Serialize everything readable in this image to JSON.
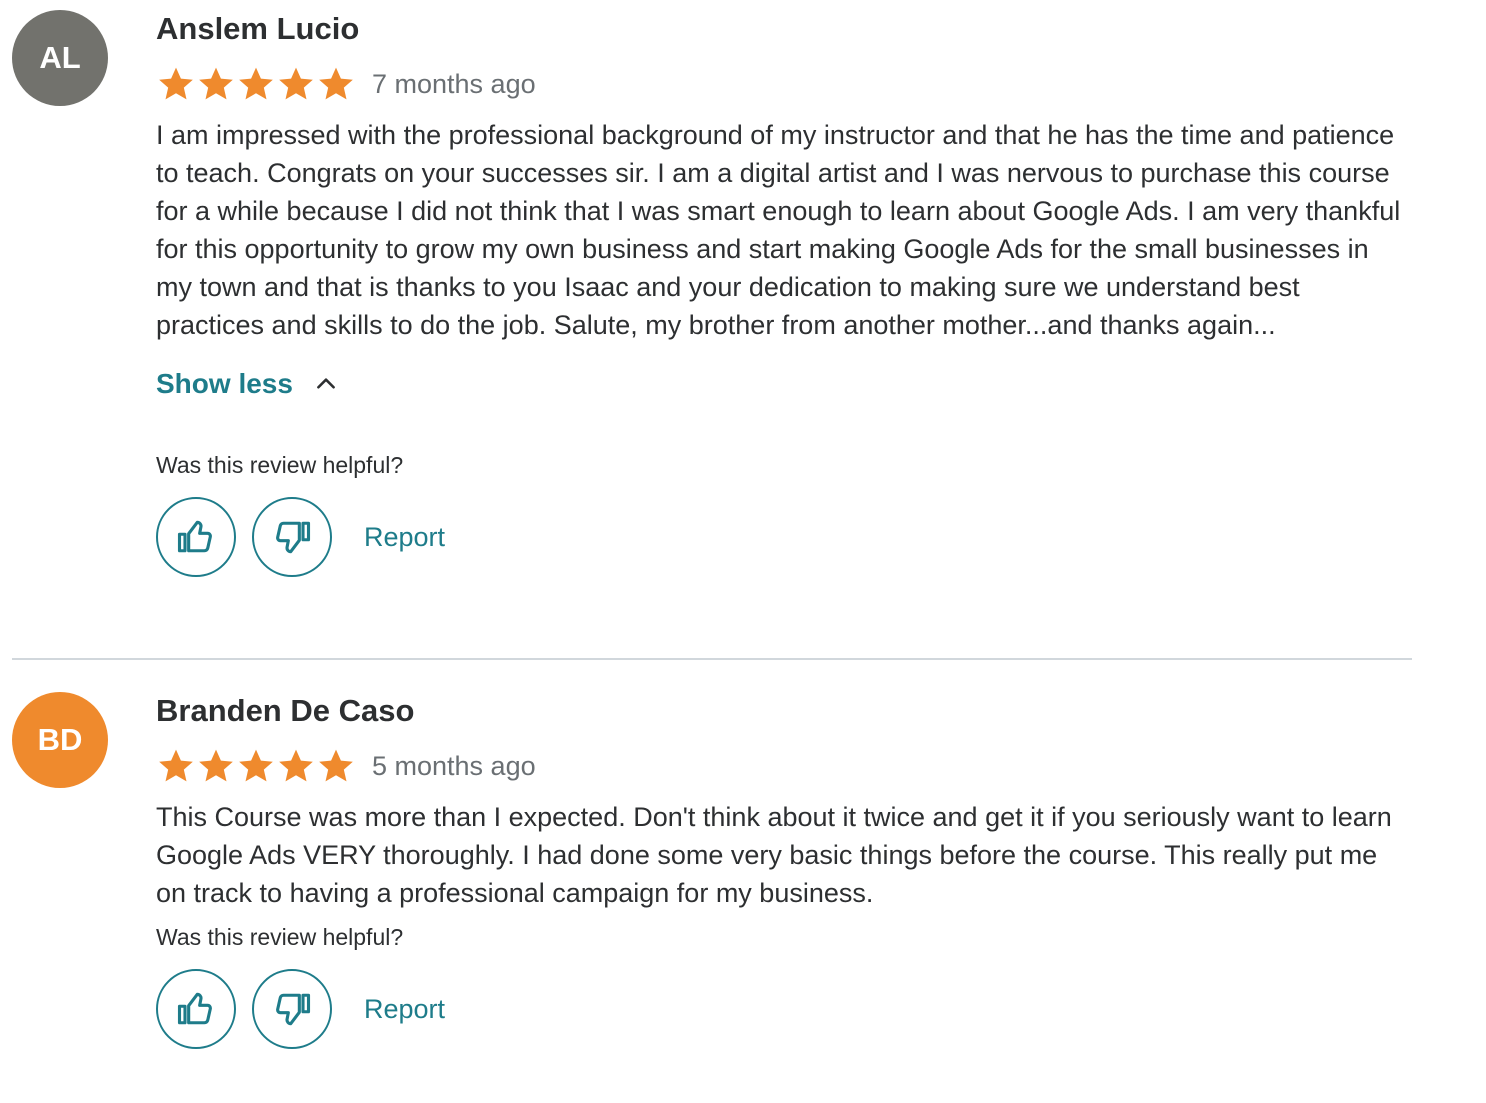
{
  "colors": {
    "accent": "#1e7c8a",
    "star": "#ef8a2d",
    "avatar_al": "#72726d",
    "avatar_bd": "#ef8a2d"
  },
  "reviews": [
    {
      "initials": "AL",
      "name": "Anslem Lucio",
      "rating": 5,
      "time": "7 months ago",
      "text": "I am impressed with the professional background of my instructor and that he has the time and patience to teach. Congrats on your successes sir. I am a digital artist and I was nervous to purchase this course for a while because I did not think that I was smart enough to learn about Google Ads. I am very thankful for this opportunity to grow my own business and start making Google Ads for the small businesses in my town and that is thanks to you Isaac and your dedication to making sure we understand best practices and skills to do the job. Salute, my brother from another mother...and thanks again...",
      "show_less_label": "Show less",
      "helpful_label": "Was this review helpful?",
      "report_label": "Report"
    },
    {
      "initials": "BD",
      "name": "Branden De Caso",
      "rating": 5,
      "time": "5 months ago",
      "text": "This Course was more than I expected. Don't think about it twice and get it if you seriously want to learn Google Ads VERY thoroughly. I had done some very basic things before the course. This really put me on track to having a professional campaign for my business.",
      "helpful_label": "Was this review helpful?",
      "report_label": "Report"
    }
  ]
}
